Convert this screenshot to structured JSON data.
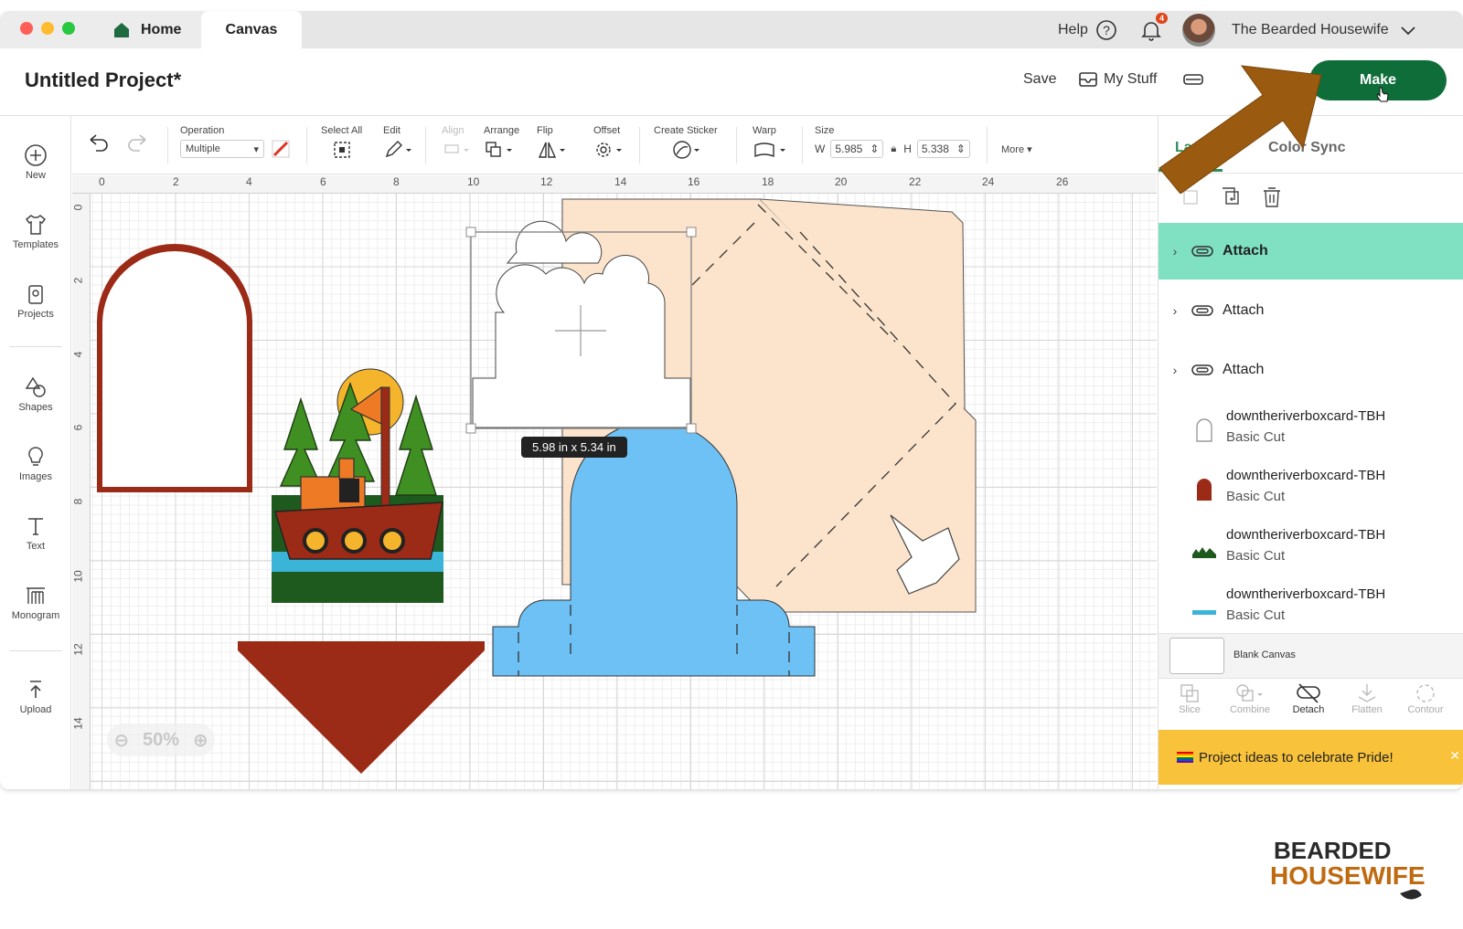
{
  "window": {
    "tabs": {
      "home": "Home",
      "canvas": "Canvas"
    },
    "help_label": "Help",
    "notification_count": "4",
    "account_name": "The Bearded Housewife"
  },
  "header": {
    "project_title": "Untitled Project*",
    "save_label": "Save",
    "mystuff_label": "My Stuff",
    "make_label": "Make"
  },
  "leftnav": {
    "new": "New",
    "templates": "Templates",
    "projects": "Projects",
    "shapes": "Shapes",
    "images": "Images",
    "text": "Text",
    "monogram": "Monogram",
    "upload": "Upload"
  },
  "toolbar": {
    "operation_label": "Operation",
    "operation_value": "Multiple",
    "select_all_label": "Select All",
    "edit_label": "Edit",
    "align_label": "Align",
    "arrange_label": "Arrange",
    "flip_label": "Flip",
    "offset_label": "Offset",
    "create_sticker_label": "Create Sticker",
    "warp_label": "Warp",
    "size_label": "Size",
    "w_label": "W",
    "w_value": "5.985",
    "h_label": "H",
    "h_value": "5.338",
    "more_label": "More"
  },
  "canvas": {
    "ruler_top": [
      "0",
      "2",
      "4",
      "6",
      "8",
      "10",
      "12",
      "14",
      "16",
      "18",
      "20",
      "22",
      "24",
      "26"
    ],
    "ruler_left": [
      "0",
      "2",
      "4",
      "6",
      "8",
      "10",
      "12",
      "14"
    ],
    "size_tooltip": "5.98  in x 5.34  in",
    "zoom_level": "50%"
  },
  "panel": {
    "tab_layers": "Layers",
    "tab_other": "Color Sync",
    "groups": [
      {
        "label": "Attach",
        "selected": true
      },
      {
        "label": "Attach",
        "selected": false
      },
      {
        "label": "Attach",
        "selected": false
      }
    ],
    "layers": [
      {
        "name": "downtheriverboxcard-TBH",
        "op": "Basic Cut",
        "color": "#ffffff"
      },
      {
        "name": "downtheriverboxcard-TBH",
        "op": "Basic Cut",
        "color": "#9b2a16"
      },
      {
        "name": "downtheriverboxcard-TBH",
        "op": "Basic Cut",
        "color": "#1e5a1e"
      },
      {
        "name": "downtheriverboxcard-TBH",
        "op": "Basic Cut",
        "color": "#3ab5d8"
      }
    ],
    "blank_canvas": "Blank Canvas",
    "tools": {
      "slice": "Slice",
      "combine": "Combine",
      "detach": "Detach",
      "flatten": "Flatten",
      "contour": "Contour"
    },
    "pride_banner": "Project ideas to celebrate Pride!"
  },
  "colors": {
    "make_button": "#0f6d3a",
    "accent_green": "#2f8f5b",
    "selected_layer": "#7fe0c2",
    "arrow": "#9a5a10",
    "banner": "#f8c23a"
  }
}
